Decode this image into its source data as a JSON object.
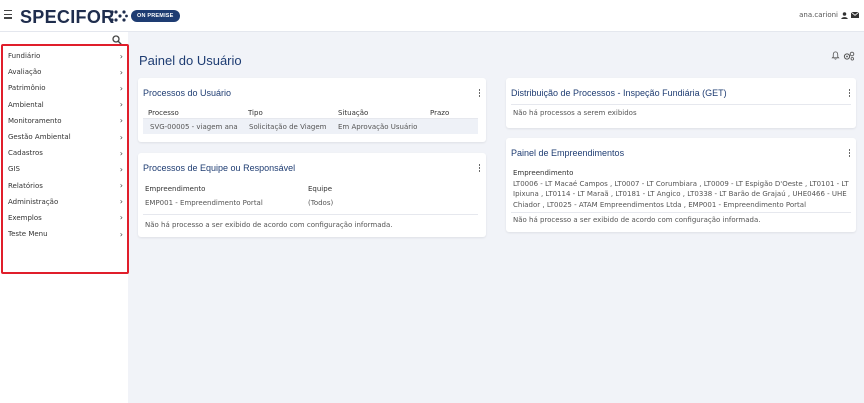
{
  "header": {
    "logo_text": "SPECIFOR",
    "badge": "ON PREMISE",
    "user": "ana.carioni"
  },
  "sidebar": {
    "items": [
      {
        "label": "Fundiário"
      },
      {
        "label": "Avaliação"
      },
      {
        "label": "Patrimônio"
      },
      {
        "label": "Ambiental"
      },
      {
        "label": "Monitoramento"
      },
      {
        "label": "Gestão Ambiental"
      },
      {
        "label": "Cadastros"
      },
      {
        "label": "GIS"
      },
      {
        "label": "Relatórios"
      },
      {
        "label": "Administração"
      },
      {
        "label": "Exemplos"
      },
      {
        "label": "Teste Menu"
      }
    ]
  },
  "page": {
    "title": "Painel do Usuário"
  },
  "processos_usuario": {
    "title": "Processos do Usuário",
    "columns": [
      "Processo",
      "Tipo",
      "Situação",
      "Prazo"
    ],
    "row": [
      "SVG-00005 - viagem ana",
      "Solicitação de Viagem",
      "Em Aprovação Usuário",
      ""
    ]
  },
  "processos_equipe": {
    "title": "Processos de Equipe ou Responsável",
    "col_emp": "Empreendimento",
    "col_equipe": "Equipe",
    "emp_value": "EMP001 - Empreendimento Portal",
    "equipe_value": "(Todos)",
    "message": "Não há processo a ser exibido de acordo com configuração informada."
  },
  "distribuicao": {
    "title": "Distribuição de Processos - Inspeção Fundiária (GET)",
    "message": "Não há processos a serem exibidos"
  },
  "empreendimentos": {
    "title": "Painel de Empreendimentos",
    "label": "Empreendimento",
    "list": "LT0006 - LT Macaé Campos , LT0007 - LT Corumbiara , LT0009 - LT Espigão D'Oeste , LT0101 - LT Ipixuna , LT0114 - LT Maraã , LT0181 - LT Angico , LT0338 - LT Barão de Grajaú , UHE0466 - UHE Chiador , LT0025 - ATAM Empreendimentos Ltda , EMP001 - Empreendimento Portal",
    "message": "Não há processo a ser exibido de acordo com configuração informada."
  },
  "colors": {
    "primary": "#1e3c72",
    "highlight_border": "#e01e2b",
    "background": "#f1f3f8"
  },
  "icons": [
    "hamburger-icon",
    "logo-dots-icon",
    "user-icon",
    "mail-icon",
    "search-icon",
    "chevron-right-icon",
    "bell-icon",
    "settings-gears-icon",
    "kebab-menu-icon"
  ]
}
